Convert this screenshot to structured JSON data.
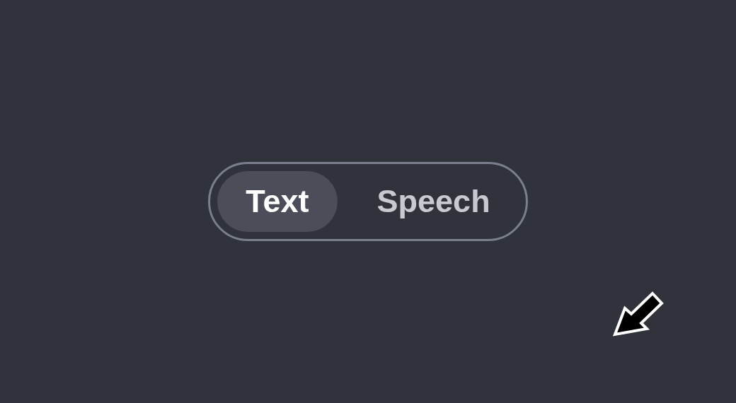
{
  "toggle": {
    "options": [
      {
        "label": "Text",
        "selected": true
      },
      {
        "label": "Speech",
        "selected": false
      }
    ]
  }
}
